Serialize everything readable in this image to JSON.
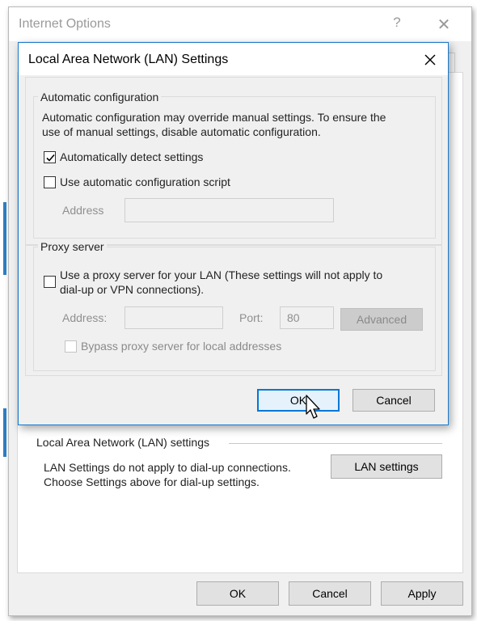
{
  "outer_window": {
    "title": "Internet Options",
    "help_glyph": "?",
    "close_glyph": "✕",
    "lan_group": {
      "title": "Local Area Network (LAN) settings",
      "description_line1": "LAN Settings do not apply to dial-up connections.",
      "description_line2": "Choose Settings above for dial-up settings.",
      "lan_settings_button": "LAN settings"
    },
    "footer": {
      "ok_label": "OK",
      "cancel_label": "Cancel",
      "apply_label": "Apply"
    }
  },
  "dialog": {
    "title": "Local Area Network (LAN) Settings",
    "auto_config": {
      "legend": "Automatic configuration",
      "description_line1": "Automatic configuration may override manual settings.  To ensure the",
      "description_line2": "use of manual settings, disable automatic configuration.",
      "auto_detect": {
        "label": "Automatically detect settings",
        "checked": true
      },
      "use_script": {
        "label": "Use automatic configuration script",
        "checked": false
      },
      "address_label": "Address",
      "address_value": ""
    },
    "proxy": {
      "legend": "Proxy server",
      "use_proxy_line1": "Use a proxy server for your LAN (These settings will not apply to",
      "use_proxy_line2": "dial-up or VPN connections).",
      "use_proxy_checked": false,
      "address_label": "Address:",
      "address_value": "",
      "port_label": "Port:",
      "port_value": "80",
      "advanced_label": "Advanced",
      "bypass_label": "Bypass proxy server for local addresses",
      "bypass_checked": false
    },
    "ok_label": "OK",
    "cancel_label": "Cancel"
  },
  "colors": {
    "accent": "#0078d7",
    "dialog_border": "#1979ca",
    "window_bg": "#f0f0f0",
    "disabled_text": "#8f8f8f"
  },
  "icons": {
    "checkmark": "checkmark-icon",
    "close": "close-icon",
    "cursor": "mouse-pointer-icon"
  }
}
